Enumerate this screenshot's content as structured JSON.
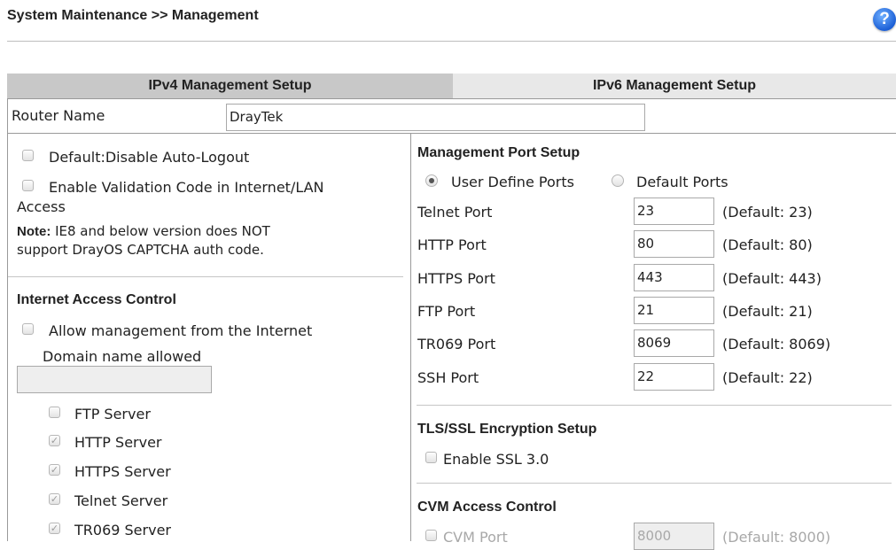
{
  "page": {
    "title": "System Maintenance >> Management",
    "help_icon": "?"
  },
  "tabs": {
    "ipv4": "IPv4 Management Setup",
    "ipv6": "IPv6 Management Setup"
  },
  "router_name": {
    "label": "Router Name",
    "value": "DrayTek"
  },
  "left": {
    "disable_auto_logout": "Default:Disable Auto-Logout",
    "validation_code_line1": "Enable Validation Code in Internet/LAN",
    "validation_code_line2": "Access",
    "note_label": "Note:",
    "note_line1": " IE8 and below version does NOT",
    "note_line2": "support DrayOS CAPTCHA auth code.",
    "iac_title": "Internet Access Control",
    "allow_mgmt": "Allow management from the Internet",
    "domain_label": "Domain name allowed",
    "domain_value": "",
    "servers": [
      {
        "label": "FTP Server",
        "checked": false
      },
      {
        "label": "HTTP Server",
        "checked": true
      },
      {
        "label": "HTTPS Server",
        "checked": true
      },
      {
        "label": "Telnet Server",
        "checked": true
      },
      {
        "label": "TR069 Server",
        "checked": true
      }
    ]
  },
  "right": {
    "mps_title": "Management Port Setup",
    "user_define": "User Define Ports",
    "default_ports": "Default Ports",
    "ports": [
      {
        "label": "Telnet Port",
        "value": "23",
        "default": "(Default: 23)"
      },
      {
        "label": "HTTP Port",
        "value": "80",
        "default": "(Default: 80)"
      },
      {
        "label": "HTTPS Port",
        "value": "443",
        "default": "(Default: 443)"
      },
      {
        "label": "FTP Port",
        "value": "21",
        "default": "(Default: 21)"
      },
      {
        "label": "TR069 Port",
        "value": "8069",
        "default": "(Default: 8069)"
      },
      {
        "label": "SSH Port",
        "value": "22",
        "default": "(Default: 22)"
      }
    ],
    "tls_title": "TLS/SSL Encryption Setup",
    "enable_ssl": "Enable SSL 3.0",
    "cvm_title": "CVM Access Control",
    "cvm_port_label": "CVM Port",
    "cvm_port_value": "8000",
    "cvm_port_default": "(Default: 8000)"
  }
}
